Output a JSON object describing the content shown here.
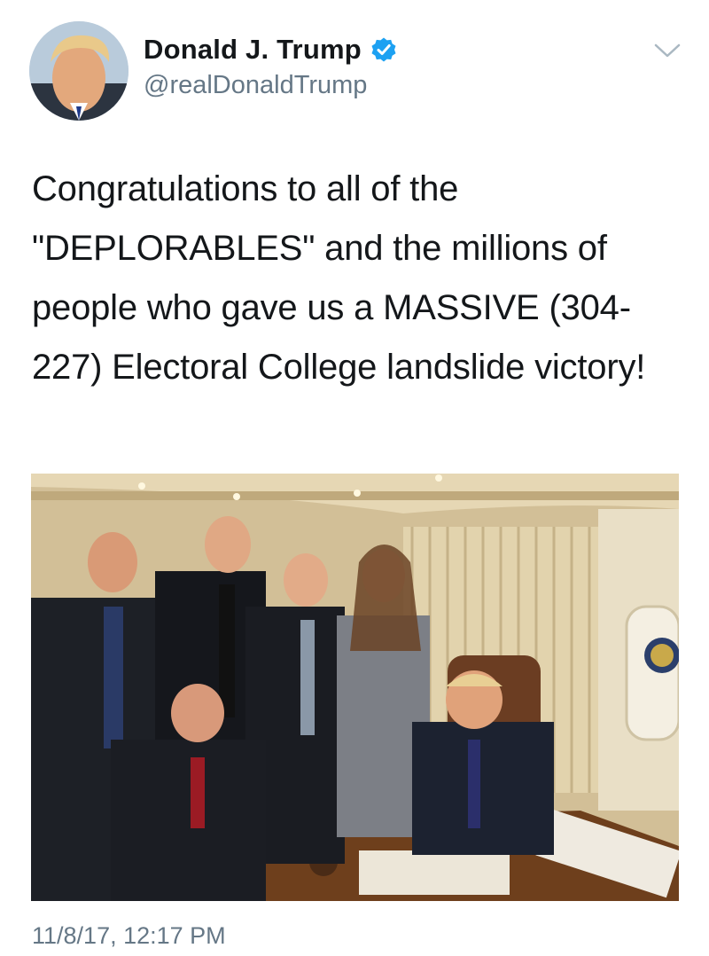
{
  "tweet": {
    "display_name": "Donald J. Trump",
    "handle": "@realDonaldTrump",
    "verified": true,
    "text": "Congratulations to all of the \"DEPLORABLES\" and the millions of people who gave us a MASSIVE (304-227) Electoral College landslide victory!",
    "timestamp": "11/8/17, 12:17 PM"
  },
  "icons": {
    "verified": "verified-badge-icon",
    "menu": "chevron-down-icon"
  },
  "colors": {
    "text": "#14171a",
    "secondary": "#657786",
    "verified_blue": "#1da1f2"
  }
}
